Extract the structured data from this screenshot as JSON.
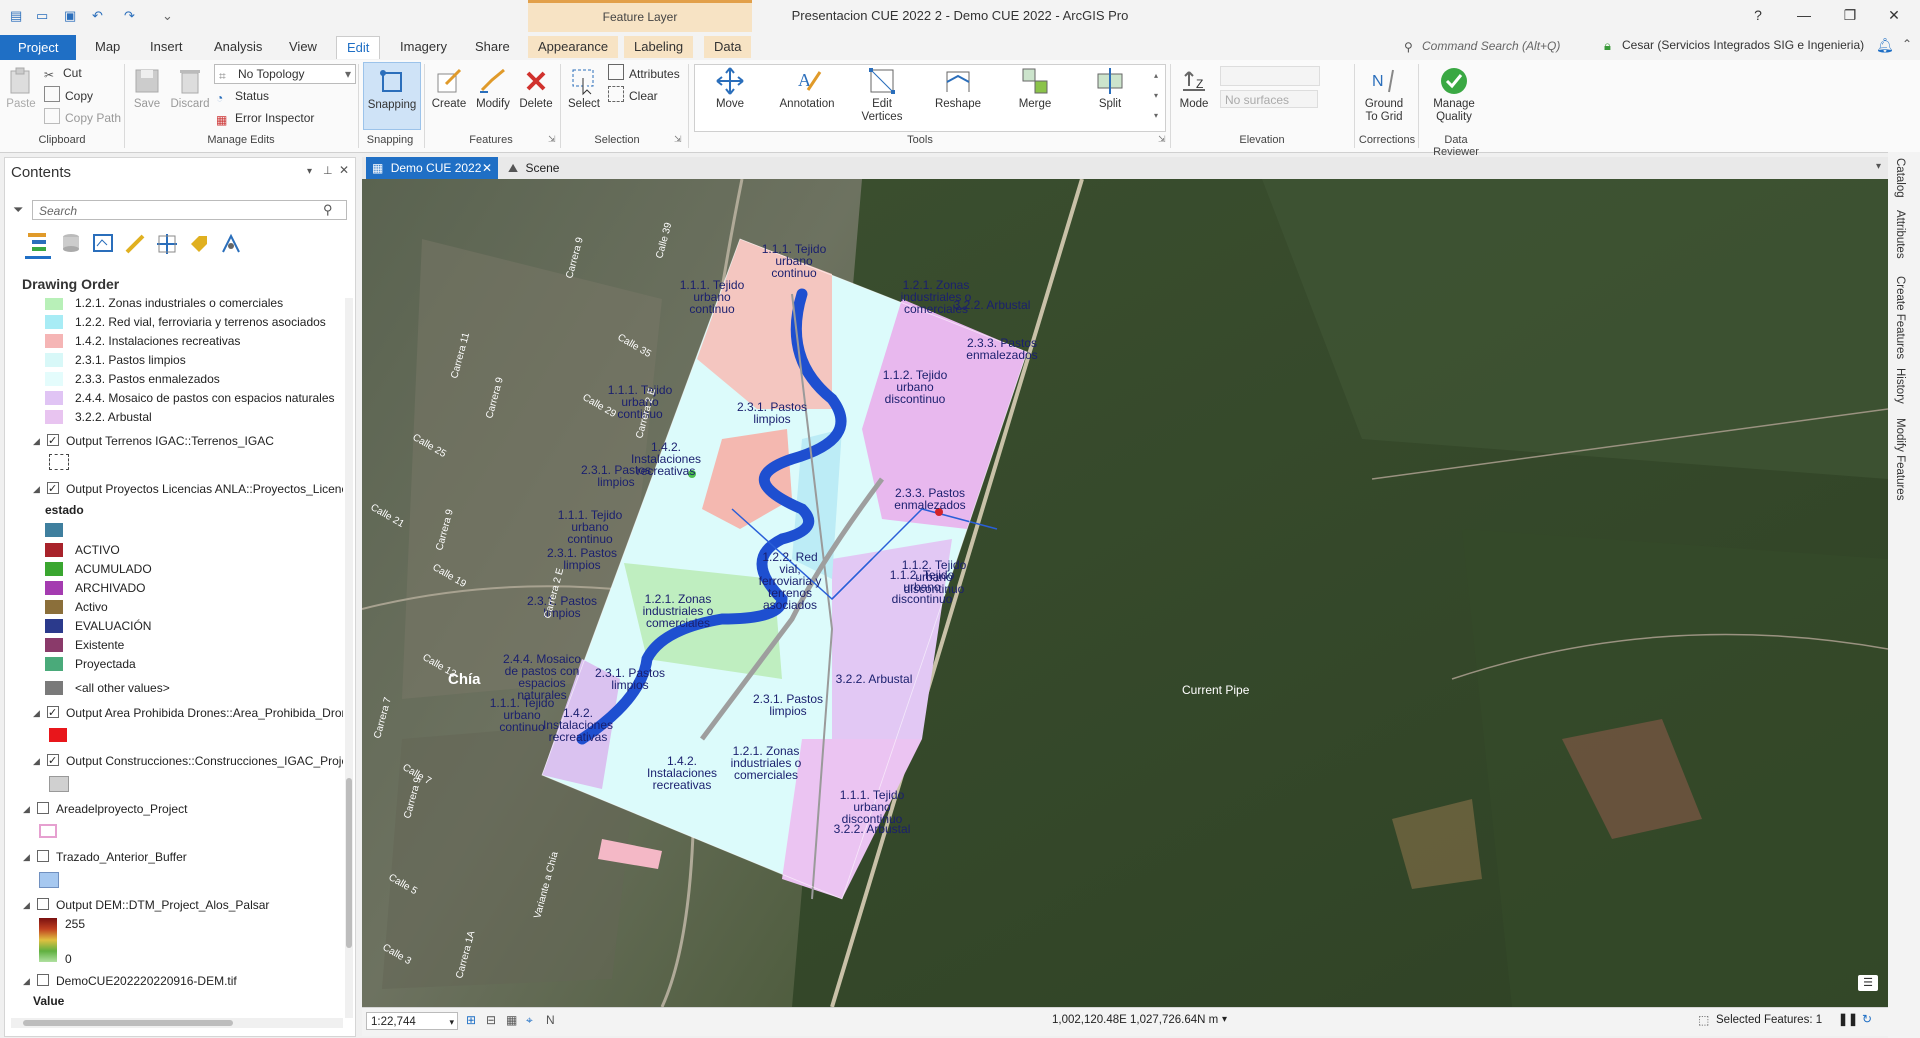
{
  "window": {
    "title": "Presentacion CUE 2022 2 - Demo CUE 2022 - ArcGIS Pro",
    "context_tab_label": "Feature Layer",
    "help": "?"
  },
  "tabs": [
    "Project",
    "Map",
    "Insert",
    "Analysis",
    "View",
    "Edit",
    "Imagery",
    "Share",
    "Appearance",
    "Labeling",
    "Data"
  ],
  "command_search": {
    "placeholder": "Command Search (Alt+Q)"
  },
  "user": {
    "name": "Cesar (Servicios Integrados SIG e Ingenieria)"
  },
  "ribbon": {
    "clipboard": {
      "paste": "Paste",
      "cut": "Cut",
      "copy": "Copy",
      "copy_path": "Copy Path",
      "label": "Clipboard"
    },
    "manage_edits": {
      "save": "Save",
      "discard": "Discard",
      "topology": "No Topology",
      "status": "Status",
      "error_inspector": "Error Inspector",
      "label": "Manage Edits"
    },
    "snapping": {
      "button": "Snapping",
      "label": "Snapping"
    },
    "features": {
      "create": "Create",
      "modify": "Modify",
      "delete": "Delete",
      "label": "Features"
    },
    "selection": {
      "select": "Select",
      "attributes": "Attributes",
      "clear": "Clear",
      "label": "Selection"
    },
    "tools": {
      "move": "Move",
      "annotation": "Annotation",
      "edit_vertices": "Edit Vertices",
      "reshape": "Reshape",
      "merge": "Merge",
      "split": "Split",
      "label": "Tools"
    },
    "elevation": {
      "mode": "Mode",
      "surfaces": "No surfaces",
      "label": "Elevation"
    },
    "corrections": {
      "ground_to_grid": "Ground To Grid",
      "label": "Corrections"
    },
    "data_reviewer": {
      "manage_quality": "Manage Quality",
      "label": "Data Reviewer"
    }
  },
  "contents": {
    "title": "Contents",
    "search_placeholder": "Search",
    "heading": "Drawing Order",
    "legend_items": [
      {
        "label": "1.2.1. Zonas industriales o comerciales",
        "color": "#b8f0b8"
      },
      {
        "label": "1.2.2. Red vial, ferroviaria y terrenos asociados",
        "color": "#a8ecf5"
      },
      {
        "label": "1.4.2. Instalaciones recreativas",
        "color": "#f5b5b5"
      },
      {
        "label": "2.3.1. Pastos limpios",
        "color": "#d8f8f8"
      },
      {
        "label": "2.3.3. Pastos enmalezados",
        "color": "#e4fcfc"
      },
      {
        "label": "2.4.4. Mosaico de pastos con espacios naturales",
        "color": "#e0c4f4"
      },
      {
        "label": "3.2.2. Arbustal",
        "color": "#e8c4f0"
      }
    ],
    "layer_terrenos": "Output Terrenos IGAC::Terrenos_IGAC",
    "layer_proyectos": "Output Proyectos Licencias ANLA::Proyectos_Licencia",
    "estado_label": "estado",
    "estado_items": [
      {
        "label": "",
        "color": "#3f7f9e"
      },
      {
        "label": "ACTIVO",
        "color": "#a8232b"
      },
      {
        "label": "ACUMULADO",
        "color": "#3aa630"
      },
      {
        "label": "ARCHIVADO",
        "color": "#a43bb0"
      },
      {
        "label": "Activo",
        "color": "#8b6f3a"
      },
      {
        "label": "EVALUACIÓN",
        "color": "#2b3a8c"
      },
      {
        "label": "Existente",
        "color": "#8a3a6a"
      },
      {
        "label": "Proyectada",
        "color": "#4aaa7a"
      },
      {
        "label": "<all other values>",
        "color": "#7a7a7a"
      }
    ],
    "layer_drones": "Output Area Prohibida Drones::Area_Prohibida_Dron",
    "layer_construcciones": "Output Construcciones::Construcciones_IGAC_Project",
    "layer_areadelproyecto": "Areadelproyecto_Project",
    "layer_trazado": "Trazado_Anterior_Buffer",
    "layer_dem": "Output DEM::DTM_Project_Alos_Palsar",
    "dem_high": "255",
    "dem_low": "0",
    "layer_demcue": "DemoCUE202220220916-DEM.tif",
    "value_label": "Value"
  },
  "view_tabs": {
    "map": "Demo CUE 2022",
    "scene": "Scene"
  },
  "map_labels": {
    "chia": "Chía",
    "current_pipe": "Current Pipe",
    "landcover": [
      "1.1.1. Tejido urbano continuo",
      "1.1.1. Tejido urbano continuo",
      "1.2.1. Zonas industriales o comerciales",
      "3.2.2. Arbustal",
      "2.3.3. Pastos enmalezados",
      "1.1.2. Tejido urbano discontinuo",
      "1.1.1. Tejido urbano continuo",
      "2.3.1. Pastos limpios",
      "1.4.2. Instalaciones recreativas",
      "2.3.1. Pastos limpios",
      "2.3.3. Pastos enmalezados",
      "1.1.1. Tejido urbano continuo",
      "1.2.2. Red vial, ferroviaria y terrenos asociados",
      "2.3.1. Pastos limpios",
      "1.1.2. Tejido urbano discontinuo",
      "1.2.1. Zonas industriales o comerciales",
      "2.3.1. Pastos limpios",
      "2.4.4. Mosaico de pastos con espacios naturales",
      "2.3.1. Pastos limpios",
      "3.2.2. Arbustal",
      "1.1.1. Tejido urbano continuo",
      "1.4.2. Instalaciones recreativas",
      "2.3.1. Pastos limpios",
      "1.4.2. Instalaciones recreativas",
      "1.2.1. Zonas industriales o comerciales",
      "1.1.2. Tejido urbano discontinuo",
      "1.1.1. Tejido urbano discontinuo",
      "3.2.2. Arbustal"
    ],
    "streets": [
      "Calle 39",
      "Carrera 9",
      "Calle 35",
      "Carrera 11",
      "Carrera 9",
      "Calle 29",
      "Calle 25",
      "Carrera 2 E",
      "Calle 21",
      "Carrera 9",
      "Calle 19",
      "Carrera 2 E",
      "Calle 12",
      "Carrera 7",
      "Calle 7",
      "Carrera 9",
      "Calle 5",
      "Variante a Chía",
      "Carrera 1A",
      "Calle 3"
    ]
  },
  "status": {
    "scale": "1:22,744",
    "coordinates": "1,002,120.48E 1,027,726.64N m",
    "selected_features": "Selected Features: 1"
  },
  "right_panes": [
    "Catalog",
    "Attributes",
    "Create Features",
    "History",
    "Modify Features"
  ]
}
